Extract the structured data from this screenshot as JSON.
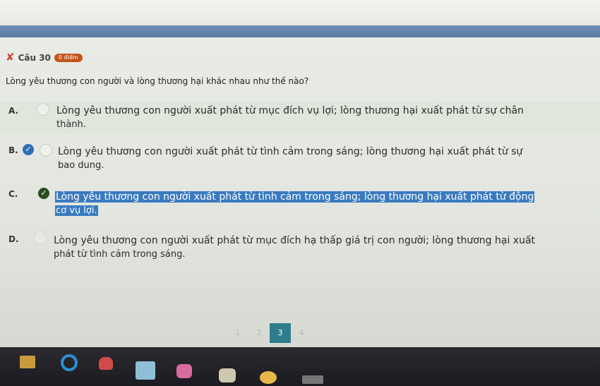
{
  "question": {
    "number_label": "Câu 30",
    "score_badge": "0 điểm",
    "text": "Lòng yêu thương con người và lòng thương hại khác nhau như thế nào?"
  },
  "options": [
    {
      "letter": "A.",
      "line1": "Lòng yêu thương con người xuất phát từ mục đích vụ lợi; lòng thương hại xuất phát từ sự chân",
      "line2": "thành."
    },
    {
      "letter": "B.",
      "line1": "Lòng yêu thương con người xuất phát từ tình cảm trong sáng; lòng thương hại xuất phát từ sự",
      "line2": "bao dung."
    },
    {
      "letter": "C.",
      "line1": "Lòng yêu thương con người xuất phát từ tình cảm trong sáng; lòng thương hại xuất phát từ động",
      "line2": "cơ vụ lợi."
    },
    {
      "letter": "D.",
      "line1": "Lòng yêu thương con người xuất phát từ mục đích hạ thấp giá trị con người; lòng thương hại xuất",
      "line2": "phát từ tình cảm trong sáng."
    }
  ],
  "pagination": [
    "1",
    "2",
    "3",
    "4"
  ],
  "colors": {
    "blue_band": "#5a7ca3",
    "selected_check": "#2d6fb8",
    "correct_check": "#2d4d1e",
    "highlight": "#3a7bbf",
    "active_page": "#2e7d8c",
    "badge": "#c4541a"
  },
  "icons": [
    "x-mark-icon",
    "check-circle-icon",
    "radio-icon",
    "taskbar-app-icon"
  ]
}
